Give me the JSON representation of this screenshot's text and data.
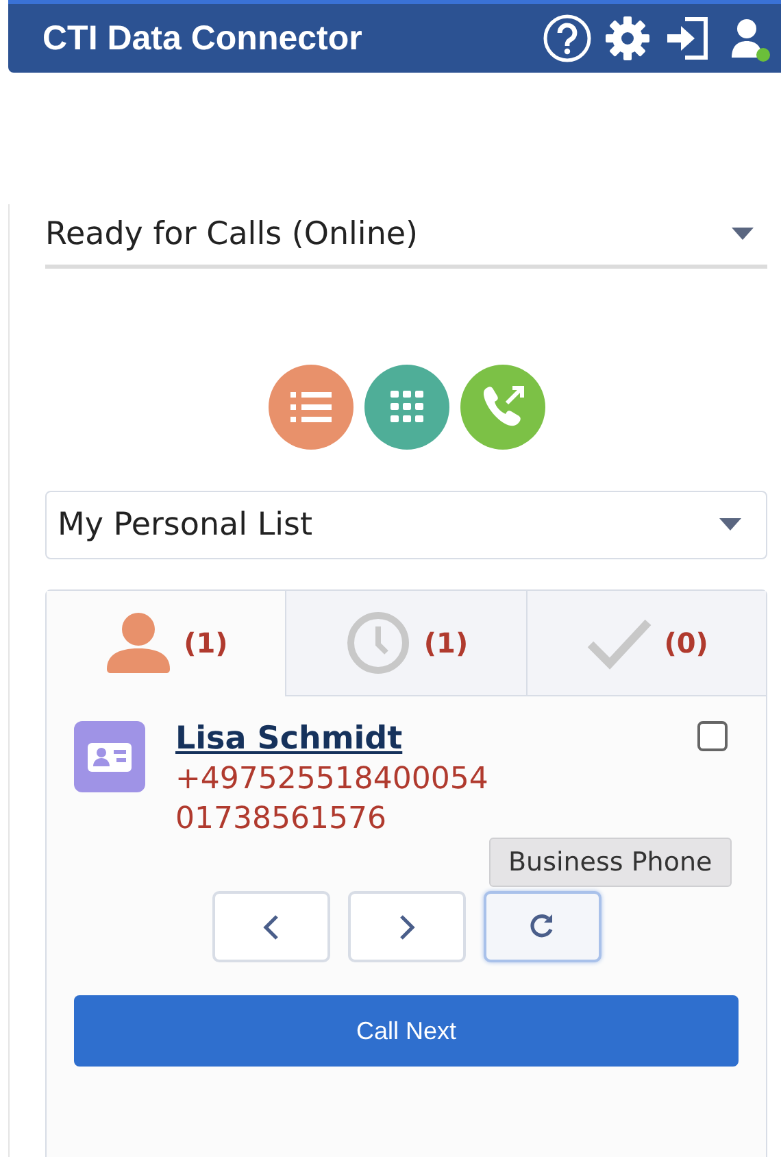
{
  "header": {
    "title": "CTI Data Connector"
  },
  "status_select": {
    "value": "Ready for Calls (Online)"
  },
  "list_select": {
    "value": "My Personal List"
  },
  "tabs": [
    {
      "kind": "person",
      "count": "(1)",
      "selected": true
    },
    {
      "kind": "clock",
      "count": "(1)",
      "selected": false
    },
    {
      "kind": "check",
      "count": "(0)",
      "selected": false
    }
  ],
  "contact": {
    "name": "Lisa Schmidt",
    "phones": [
      "+497525518400054",
      "01738561576"
    ],
    "checked": false
  },
  "nav_buttons": [
    {
      "kind": "prev",
      "focused": false
    },
    {
      "kind": "next",
      "focused": false
    },
    {
      "kind": "redial",
      "focused": true
    }
  ],
  "tooltip": "Business Phone",
  "call_button": "Call Next"
}
